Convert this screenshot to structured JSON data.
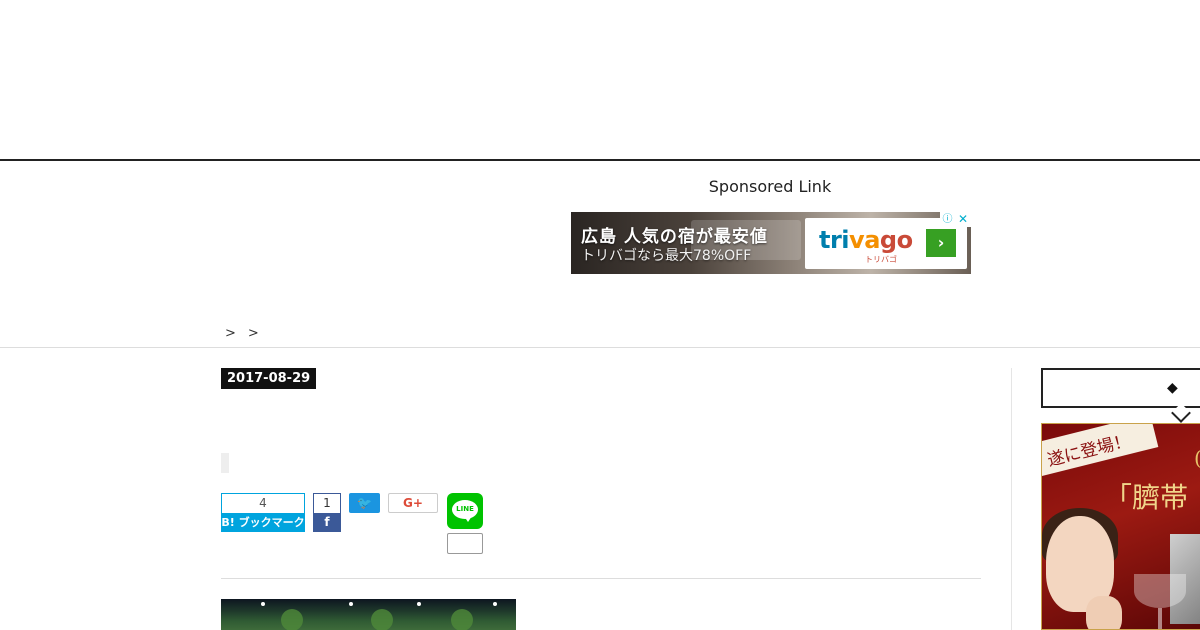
{
  "header": {},
  "sponsored": {
    "label": "Sponsored Link",
    "ad": {
      "headline": "広島 人気の宿が最安値",
      "subline": "トリバゴなら最大78%OFF",
      "brand_parts": [
        "tri",
        "va",
        "go"
      ],
      "brand_sub": "トリバゴ",
      "go_symbol": "›",
      "info_symbol": "ⓘ",
      "close_symbol": "✕",
      "colors": {
        "tri": "#007fad",
        "va": "#f48f00",
        "go": "#c94a38",
        "button": "#37a023"
      }
    }
  },
  "breadcrumb": {
    "items": [
      "",
      ""
    ],
    "separator": ">"
  },
  "article": {
    "date": "2017-08-29",
    "share": {
      "hatena_count": "4",
      "hatena_label": "B! ブックマーク",
      "facebook_count": "1",
      "facebook_icon": "f",
      "twitter_icon": "🐦",
      "gplus_label": "G+",
      "line_label": "LINE",
      "line_count": ""
    }
  },
  "sidebar": {
    "heading_symbol": "◆",
    "ad": {
      "ribbon": "遂に登場！",
      "headline": "「臍帯",
      "gold_char": "("
    }
  }
}
